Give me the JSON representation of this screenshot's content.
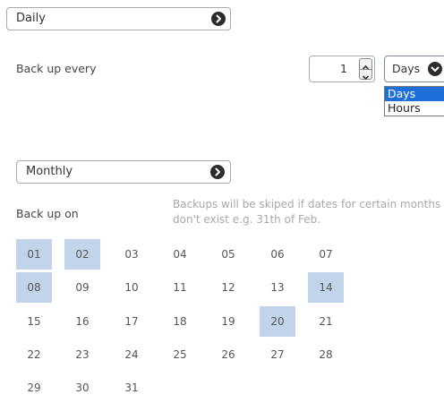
{
  "frequency_select": {
    "value": "Daily"
  },
  "backup_every": {
    "label": "Back up every",
    "interval_value": "1",
    "unit_value": "Days",
    "unit_options": [
      "Days",
      "Hours"
    ],
    "unit_highlighted": "Days"
  },
  "monthly_select": {
    "value": "Monthly"
  },
  "backup_on": {
    "label": "Back up on",
    "hint": "Backups will be skiped if dates for certain months don't exist e.g. 31th of Feb."
  },
  "days": [
    {
      "label": "01",
      "selected": true
    },
    {
      "label": "02",
      "selected": true
    },
    {
      "label": "03",
      "selected": false
    },
    {
      "label": "04",
      "selected": false
    },
    {
      "label": "05",
      "selected": false
    },
    {
      "label": "06",
      "selected": false
    },
    {
      "label": "07",
      "selected": false
    },
    {
      "label": "08",
      "selected": true
    },
    {
      "label": "09",
      "selected": false
    },
    {
      "label": "10",
      "selected": false
    },
    {
      "label": "11",
      "selected": false
    },
    {
      "label": "12",
      "selected": false
    },
    {
      "label": "13",
      "selected": false
    },
    {
      "label": "14",
      "selected": true
    },
    {
      "label": "15",
      "selected": false
    },
    {
      "label": "16",
      "selected": false
    },
    {
      "label": "17",
      "selected": false
    },
    {
      "label": "18",
      "selected": false
    },
    {
      "label": "19",
      "selected": false
    },
    {
      "label": "20",
      "selected": true
    },
    {
      "label": "21",
      "selected": false
    },
    {
      "label": "22",
      "selected": false
    },
    {
      "label": "23",
      "selected": false
    },
    {
      "label": "24",
      "selected": false
    },
    {
      "label": "25",
      "selected": false
    },
    {
      "label": "26",
      "selected": false
    },
    {
      "label": "27",
      "selected": false
    },
    {
      "label": "28",
      "selected": false
    },
    {
      "label": "29",
      "selected": false
    },
    {
      "label": "30",
      "selected": false
    },
    {
      "label": "31",
      "selected": false
    }
  ],
  "colors": {
    "selected_day_bg": "#c2d4ea",
    "dropdown_highlight": "#1e6fd9",
    "hint_text": "#a8a8a8"
  },
  "icons": {
    "select_arrow": "chevron-right-circle-icon",
    "unit_arrow": "chevron-down-circle-icon",
    "stepper": "up-down-arrows-icon"
  }
}
